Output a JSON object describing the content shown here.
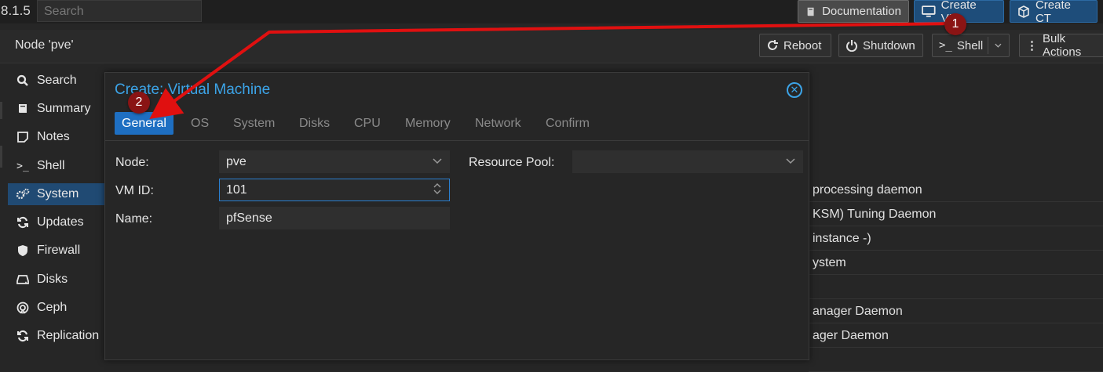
{
  "topbar": {
    "version": "8.1.5",
    "search_placeholder": "Search",
    "documentation_label": "Documentation",
    "create_vm_label": "Create VM",
    "create_ct_label": "Create CT"
  },
  "header": {
    "title": "Node 'pve'",
    "reboot_label": "Reboot",
    "shutdown_label": "Shutdown",
    "shell_label": "Shell",
    "bulk_label": "Bulk Actions"
  },
  "sidebar": {
    "items": [
      {
        "label": "Search",
        "icon": "search-icon"
      },
      {
        "label": "Summary",
        "icon": "book-icon"
      },
      {
        "label": "Notes",
        "icon": "notes-icon"
      },
      {
        "label": "Shell",
        "icon": "terminal-icon"
      },
      {
        "label": "System",
        "icon": "gears-icon"
      },
      {
        "label": "Updates",
        "icon": "refresh-icon"
      },
      {
        "label": "Firewall",
        "icon": "shield-icon"
      },
      {
        "label": "Disks",
        "icon": "disk-icon"
      },
      {
        "label": "Ceph",
        "icon": "ceph-icon"
      },
      {
        "label": "Replication",
        "icon": "replication-icon"
      }
    ]
  },
  "services": [
    "processing daemon",
    "KSM) Tuning Daemon",
    "instance -)",
    "ystem",
    "anager Daemon",
    "ager Daemon"
  ],
  "modal": {
    "title": "Create: Virtual Machine",
    "tabs": [
      "General",
      "OS",
      "System",
      "Disks",
      "CPU",
      "Memory",
      "Network",
      "Confirm"
    ],
    "node_label": "Node:",
    "node_value": "pve",
    "vmid_label": "VM ID:",
    "vmid_value": "101",
    "name_label": "Name:",
    "name_value": "pfSense",
    "pool_label": "Resource Pool:",
    "pool_value": ""
  },
  "annotations": {
    "badge1": "1",
    "badge2": "2",
    "color": "#e01010"
  },
  "colors": {
    "accent": "#3ca4e8",
    "active_tab": "#1e6fc2",
    "active_nav": "#204a73"
  }
}
